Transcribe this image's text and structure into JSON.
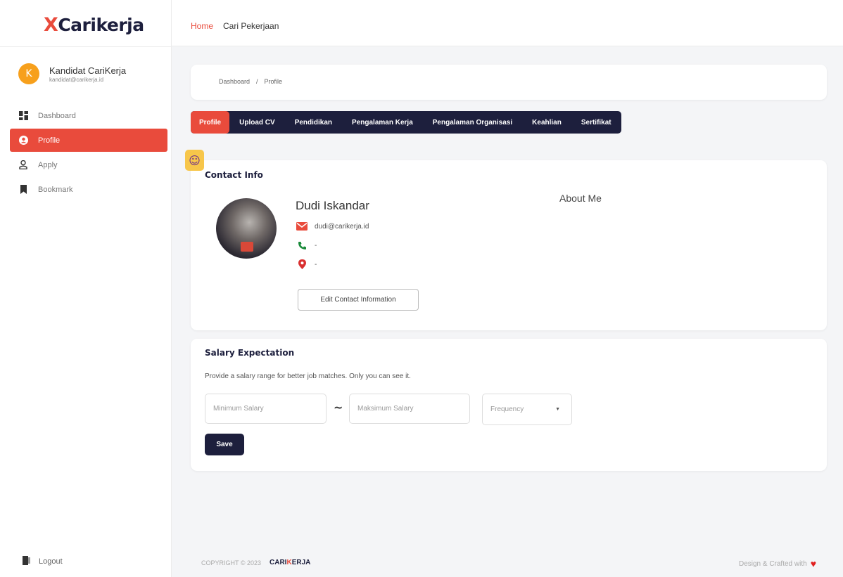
{
  "brand": {
    "x": "X",
    "name": "Carikerja"
  },
  "user": {
    "initial": "K",
    "name": "Kandidat CariKerja",
    "email": "kandidat@carikerja.id"
  },
  "sidebar": {
    "items": [
      {
        "label": "Dashboard",
        "icon": "dashboard-icon"
      },
      {
        "label": "Profile",
        "icon": "user-circle-icon",
        "active": true
      },
      {
        "label": "Apply",
        "icon": "person-icon"
      },
      {
        "label": "Bookmark",
        "icon": "bookmark-icon"
      }
    ],
    "logout": "Logout"
  },
  "topnav": {
    "home": "Home",
    "cari": "Cari Pekerjaan"
  },
  "breadcrumb": {
    "root": "Dashboard",
    "sep": "/",
    "current": "Profile"
  },
  "tabs": [
    "Profile",
    "Upload CV",
    "Pendidikan",
    "Pengalaman Kerja",
    "Pengalaman Organisasi",
    "Keahlian",
    "Sertifikat"
  ],
  "contact": {
    "title": "Contact Info",
    "name": "Dudi Iskandar",
    "email": "dudi@carikerja.id",
    "phone": "-",
    "location": "-",
    "edit_label": "Edit Contact Information",
    "about_title": "About Me"
  },
  "salary": {
    "title": "Salary Expectation",
    "description": "Provide a salary range for better job matches. Only you can see it.",
    "min_placeholder": "Minimum Salary",
    "separator": "~",
    "max_placeholder": "Maksimum Salary",
    "frequency_placeholder": "Frequency",
    "save_label": "Save"
  },
  "footer": {
    "copyright": "COPYRIGHT © 2023",
    "brand_a": "CARI",
    "brand_b": "K",
    "brand_c": "ERJA",
    "credit": "Design & Crafted with"
  },
  "colors": {
    "accent": "#e94b3c",
    "navy": "#1d1f3d",
    "avatar": "#f7a01c"
  }
}
